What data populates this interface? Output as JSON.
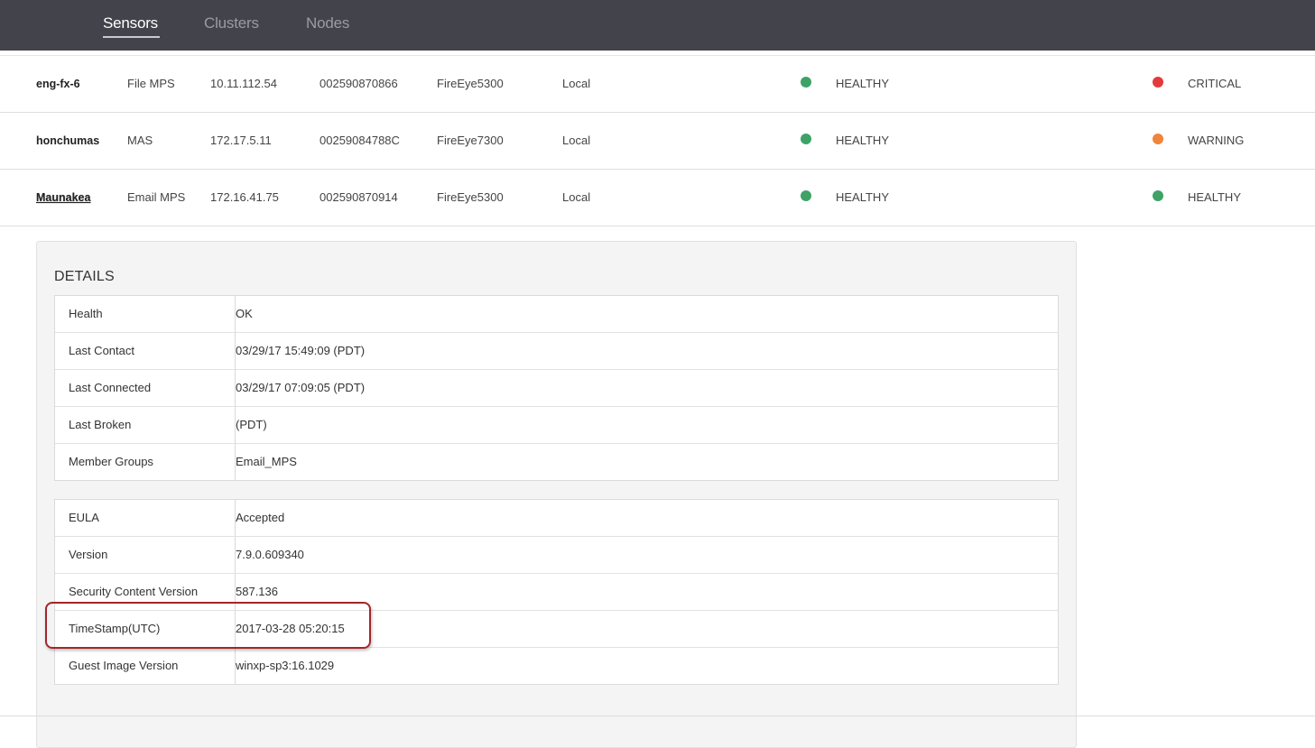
{
  "nav": {
    "tabs": [
      {
        "label": "Sensors",
        "active": true
      },
      {
        "label": "Clusters",
        "active": false
      },
      {
        "label": "Nodes",
        "active": false
      }
    ]
  },
  "colors": {
    "healthy": "#3ea267",
    "critical": "#e5393b",
    "warning": "#f0843a",
    "highlight_border": "#a3262b"
  },
  "sensors": [
    {
      "name": "eng-fx-6",
      "type": "File MPS",
      "ip": "10.11.112.54",
      "serial": "002590870866",
      "model": "FireEye5300",
      "location": "Local",
      "health_status": "HEALTHY",
      "health_color": "healthy",
      "alert_status": "CRITICAL",
      "alert_color": "critical"
    },
    {
      "name": "honchumas",
      "type": "MAS",
      "ip": "172.17.5.11",
      "serial": "00259084788C",
      "model": "FireEye7300",
      "location": "Local",
      "health_status": "HEALTHY",
      "health_color": "healthy",
      "alert_status": "WARNING",
      "alert_color": "warning"
    },
    {
      "name": "Maunakea",
      "type": "Email MPS",
      "ip": "172.16.41.75",
      "serial": "002590870914",
      "model": "FireEye5300",
      "location": "Local",
      "health_status": "HEALTHY",
      "health_color": "healthy",
      "alert_status": "HEALTHY",
      "alert_color": "healthy"
    }
  ],
  "details": {
    "title": "DETAILS",
    "table1": [
      {
        "key": "Health",
        "value": "OK"
      },
      {
        "key": "Last Contact",
        "value": "03/29/17 15:49:09 (PDT)"
      },
      {
        "key": "Last Connected",
        "value": "03/29/17 07:09:05 (PDT)"
      },
      {
        "key": "Last Broken",
        "value": "(PDT)"
      },
      {
        "key": "Member Groups",
        "value": "Email_MPS"
      }
    ],
    "table2": [
      {
        "key": "EULA",
        "value": "Accepted"
      },
      {
        "key": "Version",
        "value": "7.9.0.609340"
      },
      {
        "key": "Security Content Version",
        "value": "587.136"
      },
      {
        "key": "TimeStamp(UTC)",
        "value": "2017-03-28 05:20:15"
      },
      {
        "key": "Guest Image Version",
        "value": "winxp-sp3:16.1029"
      }
    ]
  }
}
